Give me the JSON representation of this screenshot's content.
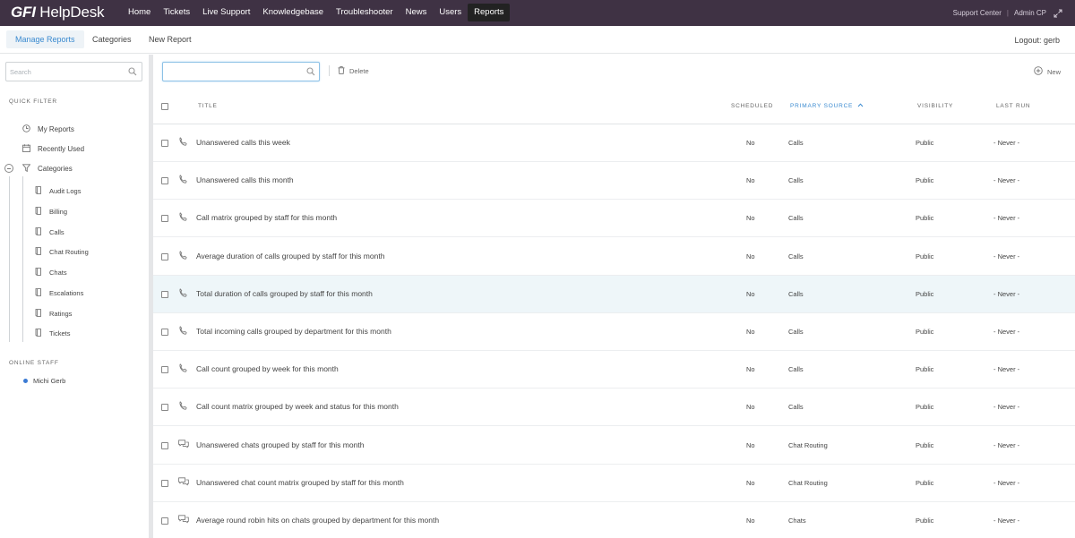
{
  "app": {
    "logo_gfi": "GFI",
    "logo_name": "HelpDesk"
  },
  "nav": {
    "items": [
      {
        "label": "Home",
        "active": false
      },
      {
        "label": "Tickets",
        "active": false
      },
      {
        "label": "Live Support",
        "active": false
      },
      {
        "label": "Knowledgebase",
        "active": false
      },
      {
        "label": "Troubleshooter",
        "active": false
      },
      {
        "label": "News",
        "active": false
      },
      {
        "label": "Users",
        "active": false
      },
      {
        "label": "Reports",
        "active": true
      }
    ],
    "support_center": "Support Center",
    "separator": "|",
    "admin_cp": "Admin CP"
  },
  "subnav": {
    "tabs": [
      {
        "label": "Manage Reports",
        "active": true
      },
      {
        "label": "Categories",
        "active": false
      },
      {
        "label": "New Report",
        "active": false
      }
    ],
    "logout": "Logout: gerb"
  },
  "sidebar": {
    "search_placeholder": "Search",
    "quick_filter_label": "QUICK FILTER",
    "filters": [
      {
        "label": "My Reports",
        "icon": "clock-icon"
      },
      {
        "label": "Recently Used",
        "icon": "calendar-icon"
      },
      {
        "label": "Categories",
        "icon": "funnel-icon"
      }
    ],
    "categories": [
      {
        "label": "Audit Logs"
      },
      {
        "label": "Billing"
      },
      {
        "label": "Calls"
      },
      {
        "label": "Chat Routing"
      },
      {
        "label": "Chats"
      },
      {
        "label": "Escalations"
      },
      {
        "label": "Ratings"
      },
      {
        "label": "Tickets"
      }
    ],
    "online_staff_label": "ONLINE STAFF",
    "online_staff": [
      {
        "name": "Michi Gerb",
        "status_color": "#3b7bd4"
      }
    ]
  },
  "toolbar": {
    "search_value": "",
    "delete_label": "Delete",
    "new_label": "New"
  },
  "table": {
    "columns": {
      "title": "TITLE",
      "scheduled": "SCHEDULED",
      "primary_source": "PRIMARY SOURCE",
      "visibility": "VISIBILITY",
      "last_run": "LAST RUN"
    },
    "sorted_column": "primary_source",
    "sort_direction": "ascending",
    "rows": [
      {
        "icon": "phone-icon",
        "title": "Unanswered calls this week",
        "scheduled": "No",
        "source": "Calls",
        "visibility": "Public",
        "last_run": "- Never -"
      },
      {
        "icon": "phone-icon",
        "title": "Unanswered calls this month",
        "scheduled": "No",
        "source": "Calls",
        "visibility": "Public",
        "last_run": "- Never -"
      },
      {
        "icon": "phone-icon",
        "title": "Call matrix grouped by staff for this month",
        "scheduled": "No",
        "source": "Calls",
        "visibility": "Public",
        "last_run": "- Never -"
      },
      {
        "icon": "phone-icon",
        "title": "Average duration of calls grouped by staff for this month",
        "scheduled": "No",
        "source": "Calls",
        "visibility": "Public",
        "last_run": "- Never -"
      },
      {
        "icon": "phone-icon",
        "title": "Total duration of calls grouped by staff for this month",
        "scheduled": "No",
        "source": "Calls",
        "visibility": "Public",
        "last_run": "- Never -",
        "highlighted": true
      },
      {
        "icon": "phone-icon",
        "title": "Total incoming calls grouped by department for this month",
        "scheduled": "No",
        "source": "Calls",
        "visibility": "Public",
        "last_run": "- Never -"
      },
      {
        "icon": "phone-icon",
        "title": "Call count grouped by week for this month",
        "scheduled": "No",
        "source": "Calls",
        "visibility": "Public",
        "last_run": "- Never -"
      },
      {
        "icon": "phone-icon",
        "title": "Call count matrix grouped by week and status for this month",
        "scheduled": "No",
        "source": "Calls",
        "visibility": "Public",
        "last_run": "- Never -"
      },
      {
        "icon": "chat-icon",
        "title": "Unanswered chats grouped by staff for this month",
        "scheduled": "No",
        "source": "Chat Routing",
        "visibility": "Public",
        "last_run": "- Never -"
      },
      {
        "icon": "chat-icon",
        "title": "Unanswered chat count matrix grouped by staff for this month",
        "scheduled": "No",
        "source": "Chat Routing",
        "visibility": "Public",
        "last_run": "- Never -"
      },
      {
        "icon": "chat-icon",
        "title": "Average round robin hits on chats grouped by department for this month",
        "scheduled": "No",
        "source": "Chats",
        "visibility": "Public",
        "last_run": "- Never -"
      }
    ]
  }
}
